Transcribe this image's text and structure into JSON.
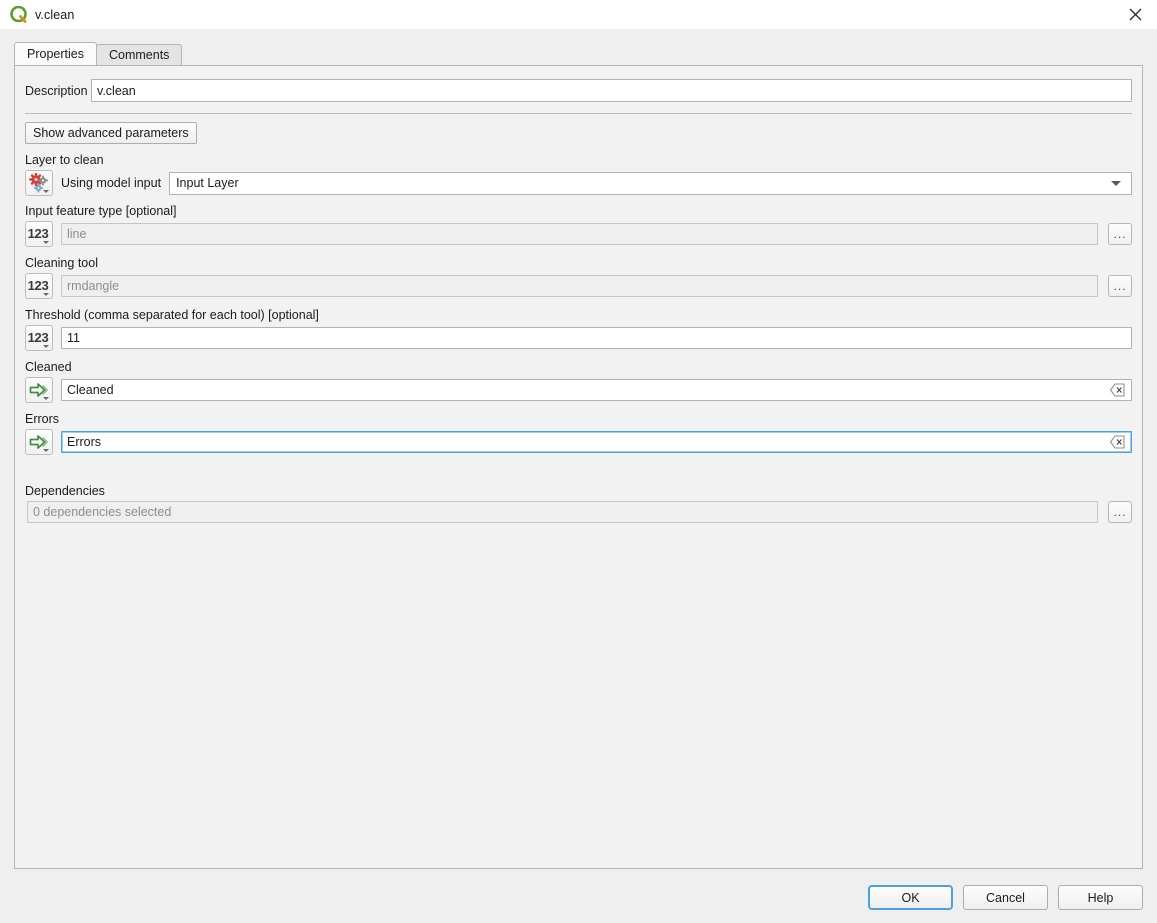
{
  "window": {
    "title": "v.clean",
    "logo_icon": "qgis-logo-icon",
    "close_icon": "close-icon"
  },
  "tabs": [
    {
      "label": "Properties",
      "selected": true
    },
    {
      "label": "Comments",
      "selected": false
    }
  ],
  "form": {
    "description": {
      "label": "Description",
      "value": "v.clean"
    },
    "show_advanced_button": "Show advanced parameters",
    "layer_to_clean": {
      "caption": "Layer to clean",
      "icon": "model-input-gears-icon",
      "mode_label": "Using model input",
      "selected_value": "Input Layer",
      "dropdown_icon": "chevron-down-icon"
    },
    "input_feature_type": {
      "caption": "Input feature type [optional]",
      "icon": "number-123-icon",
      "value": "line",
      "disabled": true,
      "browse_label": "..."
    },
    "cleaning_tool": {
      "caption": "Cleaning tool",
      "icon": "number-123-icon",
      "value": "rmdangle",
      "disabled": true,
      "browse_label": "..."
    },
    "threshold": {
      "caption": "Threshold (comma separated for each tool) [optional]",
      "icon": "number-123-icon",
      "value": "11",
      "disabled": false
    },
    "cleaned": {
      "caption": "Cleaned",
      "icon": "output-arrow-icon",
      "value": "Cleaned",
      "clear_icon": "clear-text-icon",
      "focused": false
    },
    "errors": {
      "caption": "Errors",
      "icon": "output-arrow-icon",
      "value": "Errors",
      "clear_icon": "clear-text-icon",
      "focused": true
    },
    "dependencies": {
      "caption": "Dependencies",
      "value": "0 dependencies selected",
      "browse_label": "..."
    }
  },
  "buttons": {
    "ok": "OK",
    "cancel": "Cancel",
    "help": "Help"
  },
  "colors": {
    "accent": "#4aa3e0",
    "window_bg": "#efefef",
    "panel_bg": "#f2f2f2",
    "icon_green": "#58a055",
    "icon_red": "#e03030"
  }
}
